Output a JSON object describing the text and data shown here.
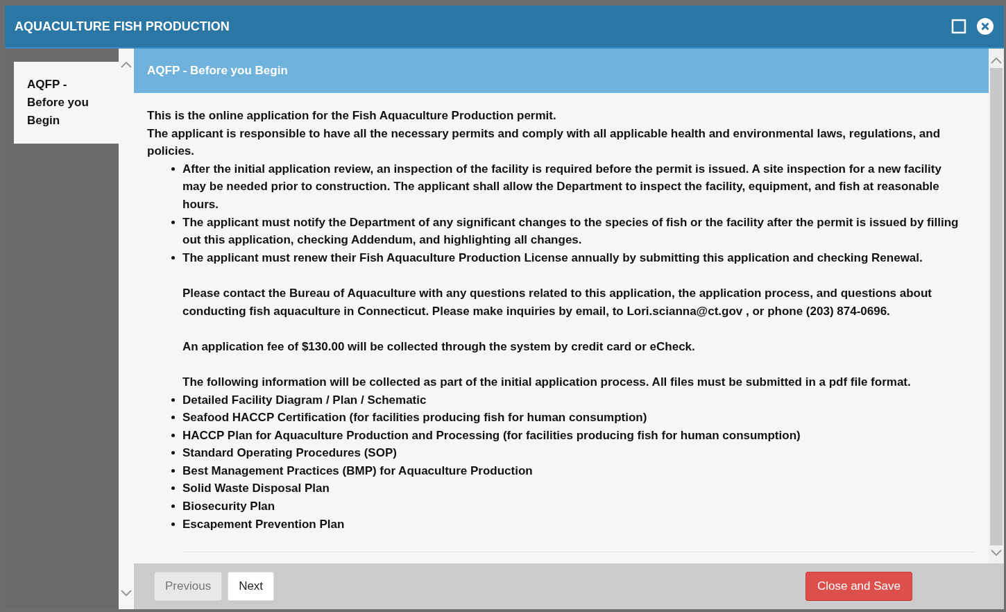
{
  "window": {
    "title": "AQUACULTURE FISH PRODUCTION"
  },
  "sidebar": {
    "items": [
      {
        "label": "AQFP - Before you Begin",
        "selected": true
      }
    ]
  },
  "section": {
    "title": "AQFP - Before you Begin"
  },
  "intro": [
    "This is the online application for the Fish Aquaculture Production permit.",
    "The applicant is responsible to have all the necessary permits and comply with all applicable health and environmental laws, regulations, and policies."
  ],
  "blocks": [
    {
      "kind": "bullet",
      "text": "After the initial application review, an inspection of the facility is required before the permit is issued. A site inspection for a new facility may be needed prior to construction. The applicant shall allow the Department to inspect the facility, equipment, and fish at reasonable hours."
    },
    {
      "kind": "bullet",
      "text": "The applicant must notify the Department of any significant changes to the species of fish or the facility after the permit is issued by filling out this application, checking Addendum, and highlighting all changes."
    },
    {
      "kind": "bullet",
      "text": "The applicant must renew their Fish Aquaculture Production License annually by submitting this application and checking Renewal."
    },
    {
      "kind": "note",
      "text": "Please contact the Bureau of Aquaculture with any questions related to this application, the application process, and questions about conducting fish aquaculture in Connecticut. Please make inquiries by email, to Lori.scianna@ct.gov , or phone (203) 874-0696."
    },
    {
      "kind": "note",
      "text": "An application fee of $130.00 will be collected through the system by credit card or eCheck."
    },
    {
      "kind": "note",
      "text": "The following information will be collected as part of the initial application process. All files must be submitted in a pdf file format."
    },
    {
      "kind": "bullet",
      "text": "Detailed Facility Diagram / Plan / Schematic"
    },
    {
      "kind": "bullet",
      "text": "Seafood HACCP Certification (for facilities producing fish for human consumption)"
    },
    {
      "kind": "bullet",
      "text": "HACCP Plan for Aquaculture Production and Processing (for facilities producing fish for human consumption)"
    },
    {
      "kind": "bullet",
      "text": "Standard Operating Procedures (SOP)"
    },
    {
      "kind": "bullet",
      "text": "Best Management Practices (BMP) for Aquaculture Production"
    },
    {
      "kind": "bullet",
      "text": "Solid Waste Disposal Plan"
    },
    {
      "kind": "bullet",
      "text": "Biosecurity Plan"
    },
    {
      "kind": "bullet",
      "text": "Escapement Prevention Plan"
    }
  ],
  "footer": {
    "buttons": [
      {
        "label": "Previous",
        "kind": "default",
        "disabled": true
      },
      {
        "label": "Next",
        "kind": "default",
        "disabled": false
      },
      {
        "label": "Close and Save",
        "kind": "danger",
        "disabled": false
      }
    ]
  }
}
